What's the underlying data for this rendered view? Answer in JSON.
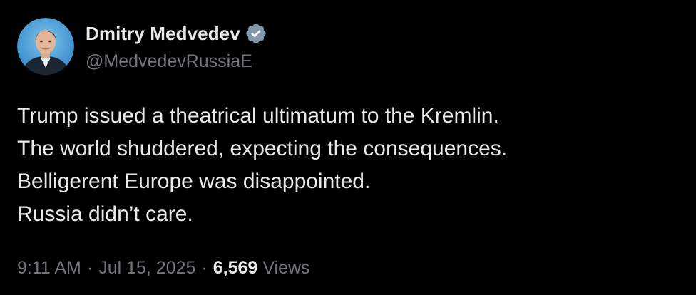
{
  "author": {
    "display_name": "Dmitry Medvedev",
    "handle": "@MedvedevRussiaE",
    "verified_icon": "verified-badge-icon",
    "avatar_ring_color": "#3b97d3"
  },
  "tweet": {
    "lines": [
      "Trump issued a theatrical ultimatum to the Kremlin.",
      "The world shuddered, expecting the consequences.",
      "Belligerent Europe was disappointed.",
      "Russia didn’t care."
    ]
  },
  "meta": {
    "time": "9:11 AM",
    "separator": "·",
    "date": "Jul 15, 2025",
    "views_count": "6,569",
    "views_label": "Views"
  },
  "colors": {
    "background": "#000000",
    "primary_text": "#e7e9ea",
    "secondary_text": "#71767b",
    "verified_badge": "#829aab"
  }
}
